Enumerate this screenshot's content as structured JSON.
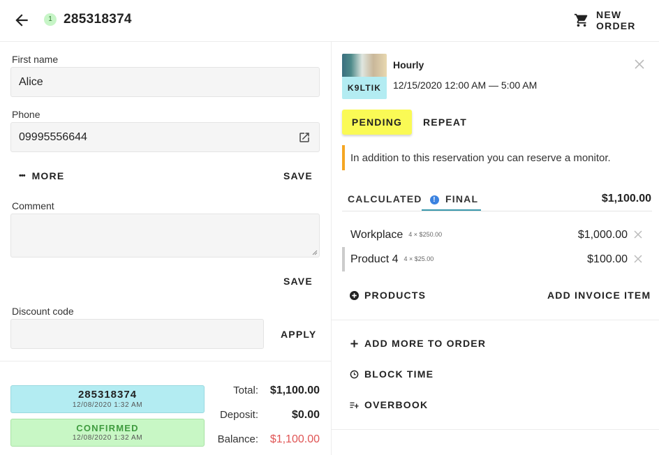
{
  "header": {
    "badge_count": "1",
    "order_id": "285318374",
    "new_order_label": "NEW ORDER"
  },
  "form": {
    "first_name_label": "First name",
    "first_name_value": "Alice",
    "phone_label": "Phone",
    "phone_value": "09995556644",
    "more_label": "MORE",
    "save_label": "SAVE",
    "comment_label": "Comment",
    "comment_value": "",
    "comment_save_label": "SAVE",
    "discount_label": "Discount code",
    "discount_value": "",
    "apply_label": "APPLY"
  },
  "summary": {
    "id_box": {
      "title": "285318374",
      "date": "12/08/2020 1:32 AM",
      "color": "#b3ecf2"
    },
    "status_box": {
      "title": "CONFIRMED",
      "date": "12/08/2020 1:32 AM",
      "color": "#c8f7c5"
    },
    "total_label": "Total:",
    "total_value": "$1,100.00",
    "deposit_label": "Deposit:",
    "deposit_value": "$0.00",
    "balance_label": "Balance:",
    "balance_value": "$1,100.00",
    "balance_color": "#e05555"
  },
  "service": {
    "tag": "K9LTIK",
    "title": "Hourly",
    "time": "12/15/2020 12:00 AM — 5:00 AM",
    "status_button": "PENDING",
    "status_color": "#fafa55",
    "repeat_label": "REPEAT",
    "notice": "In addition to this reservation you can reserve a monitor.",
    "notice_color": "#f5a623"
  },
  "invoice": {
    "tab_calculated": "CALCULATED",
    "tab_final": "FINAL",
    "total": "$1,100.00",
    "items": [
      {
        "name": "Workplace",
        "qty": "4 × $250.00",
        "price": "$1,000.00"
      },
      {
        "name": "Product 4",
        "qty": "4 × $25.00",
        "price": "$100.00"
      }
    ],
    "products_label": "PRODUCTS",
    "add_invoice_item_label": "ADD INVOICE ITEM"
  },
  "actions": {
    "add_more_label": "ADD MORE TO ORDER",
    "block_time_label": "BLOCK TIME",
    "overbook_label": "OVERBOOK"
  },
  "icons": {
    "back": "arrow-left-icon",
    "cart": "cart-icon",
    "external": "external-link-icon",
    "close": "close-icon",
    "info": "info-icon",
    "plus_circle": "plus-circle-icon",
    "plus": "plus-icon",
    "clock": "clock-icon",
    "overbook": "list-plus-icon"
  }
}
